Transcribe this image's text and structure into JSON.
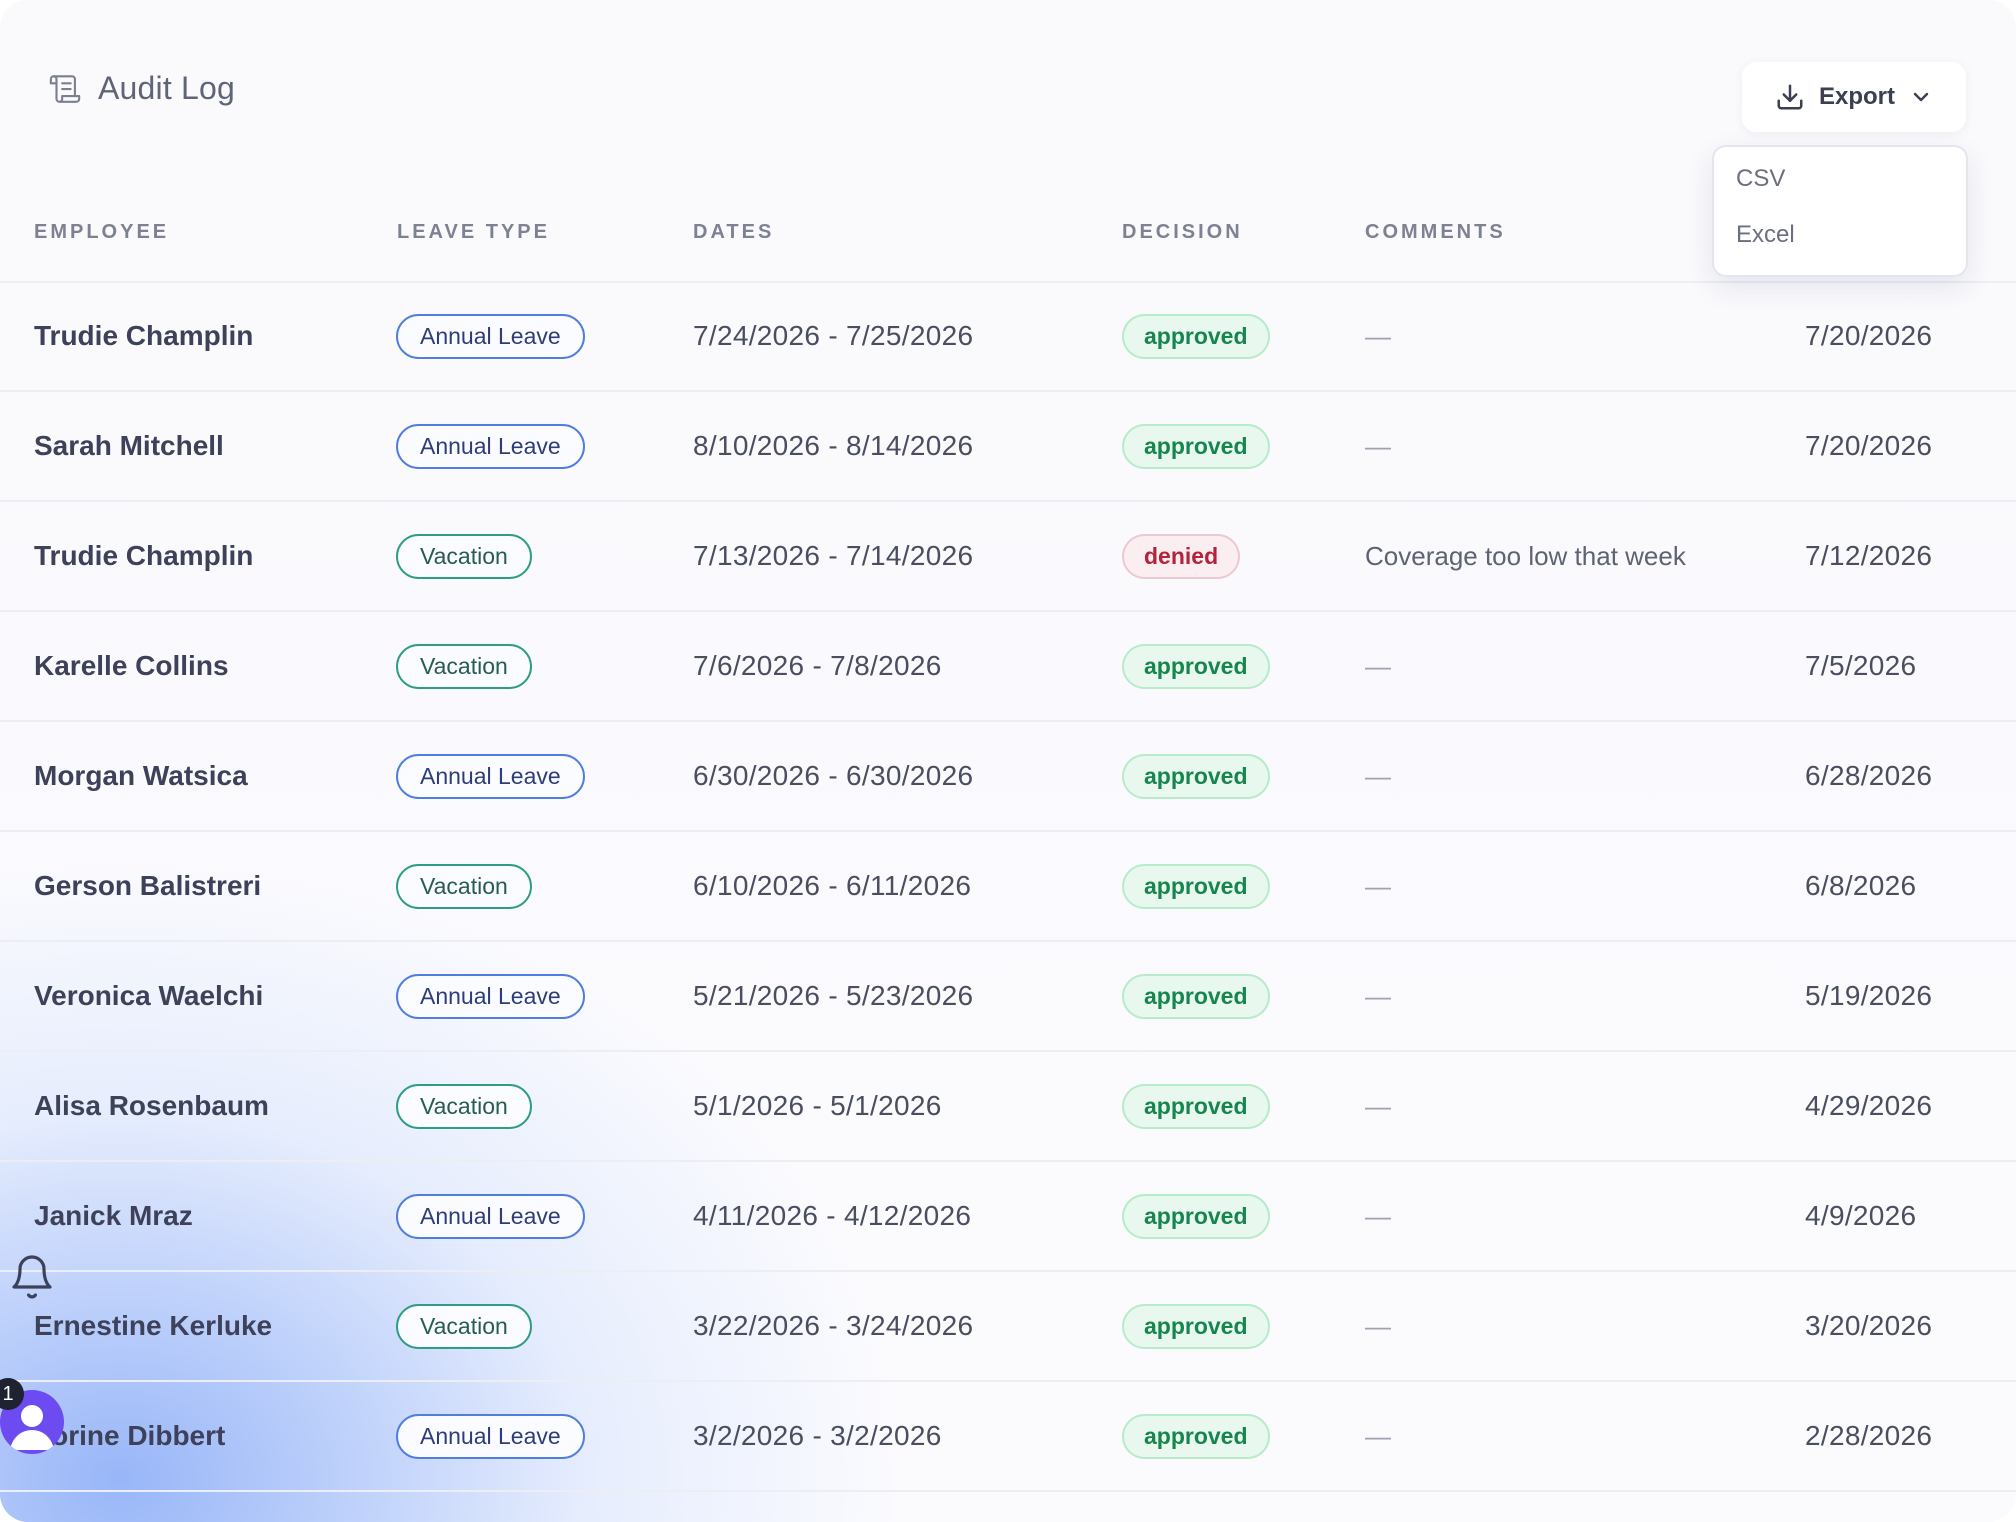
{
  "header": {
    "title": "Audit Log",
    "title_icon": "scroll-icon",
    "export_label": "Export",
    "export_icon": "download-icon",
    "chevron_icon": "chevron-down-icon"
  },
  "export_menu": {
    "items": [
      "CSV",
      "Excel"
    ]
  },
  "columns": [
    "EMPLOYEE",
    "LEAVE TYPE",
    "DATES",
    "DECISION",
    "COMMENTS"
  ],
  "rows": [
    {
      "employee": "Trudie Champlin",
      "leave_type": "Annual Leave",
      "dates": "7/24/2026 - 7/25/2026",
      "decision": "approved",
      "comment": "—",
      "date": "7/20/2026"
    },
    {
      "employee": "Sarah Mitchell",
      "leave_type": "Annual Leave",
      "dates": "8/10/2026 - 8/14/2026",
      "decision": "approved",
      "comment": "—",
      "date": "7/20/2026"
    },
    {
      "employee": "Trudie Champlin",
      "leave_type": "Vacation",
      "dates": "7/13/2026 - 7/14/2026",
      "decision": "denied",
      "comment": "Coverage too low that week",
      "date": "7/12/2026"
    },
    {
      "employee": "Karelle Collins",
      "leave_type": "Vacation",
      "dates": "7/6/2026 - 7/8/2026",
      "decision": "approved",
      "comment": "—",
      "date": "7/5/2026"
    },
    {
      "employee": "Morgan Watsica",
      "leave_type": "Annual Leave",
      "dates": "6/30/2026 - 6/30/2026",
      "decision": "approved",
      "comment": "—",
      "date": "6/28/2026"
    },
    {
      "employee": "Gerson Balistreri",
      "leave_type": "Vacation",
      "dates": "6/10/2026 - 6/11/2026",
      "decision": "approved",
      "comment": "—",
      "date": "6/8/2026"
    },
    {
      "employee": "Veronica Waelchi",
      "leave_type": "Annual Leave",
      "dates": "5/21/2026 - 5/23/2026",
      "decision": "approved",
      "comment": "—",
      "date": "5/19/2026"
    },
    {
      "employee": "Alisa Rosenbaum",
      "leave_type": "Vacation",
      "dates": "5/1/2026 - 5/1/2026",
      "decision": "approved",
      "comment": "—",
      "date": "4/29/2026"
    },
    {
      "employee": "Janick Mraz",
      "leave_type": "Annual Leave",
      "dates": "4/11/2026 - 4/12/2026",
      "decision": "approved",
      "comment": "—",
      "date": "4/9/2026"
    },
    {
      "employee": "Ernestine Kerluke",
      "leave_type": "Vacation",
      "dates": "3/22/2026 - 3/24/2026",
      "decision": "approved",
      "comment": "—",
      "date": "3/20/2026"
    },
    {
      "employee": "Lorine Dibbert",
      "leave_type": "Annual Leave",
      "dates": "3/2/2026 - 3/2/2026",
      "decision": "approved",
      "comment": "—",
      "date": "2/28/2026"
    }
  ],
  "floating": {
    "bell_icon": "bell-icon",
    "avatar_icon": "user-avatar-icon",
    "notification_count": "1"
  },
  "colors": {
    "annual_border": "#4f7de0",
    "vacation_border": "#2f9c86",
    "approved": "#17854e",
    "denied": "#b4233e",
    "avatar": "#6c4cf0"
  }
}
